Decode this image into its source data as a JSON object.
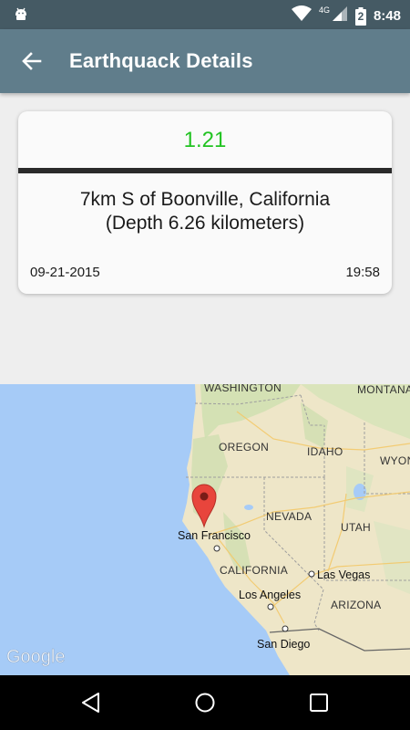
{
  "status": {
    "network": "4G",
    "battery": "2",
    "time": "8:48"
  },
  "app_bar": {
    "title": "Earthquack Details"
  },
  "quake": {
    "magnitude": "1.21",
    "place": "7km S of Boonville, California",
    "depth": "(Depth 6.26 kilometers)",
    "date": "09-21-2015",
    "time": "19:58"
  },
  "map": {
    "labels": {
      "washington": "WASHINGTON",
      "montana": "MONTANA",
      "oregon": "OREGON",
      "idaho": "IDAHO",
      "wyoming": "WYON",
      "nevada": "NEVADA",
      "utah": "UTAH",
      "san_francisco": "San Francisco",
      "california": "CALIFORNIA",
      "las_vegas": "Las Vegas",
      "los_angeles": "Los Angeles",
      "arizona": "ARIZONA",
      "san_diego": "San Diego"
    },
    "watermark": "Google"
  },
  "colors": {
    "status_bar": "#455a64",
    "app_bar": "#607d8b",
    "magnitude": "#22c322",
    "marker": "#e8453c",
    "water": "#a6cbf7"
  }
}
